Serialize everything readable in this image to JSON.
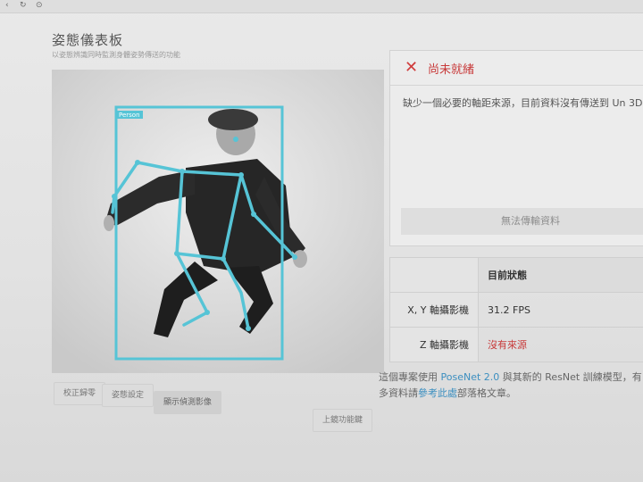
{
  "header": {
    "title": "姿態儀表板",
    "subtitle": "以姿態辨識同時監測身體姿勢傳送的功能"
  },
  "video": {
    "box_label": "Person"
  },
  "bottom_buttons": {
    "btn1": "校正歸零",
    "btn2": "姿態設定",
    "btn3": "顯示偵測影像",
    "btn4": "上鏡功能鍵"
  },
  "status": {
    "title": "尚未就緒",
    "message": "缺少一個必要的軸距來源，目前資料沒有傳送到 Un 3D。",
    "send_button": "無法傳輸資料"
  },
  "table": {
    "header": "目前狀態",
    "rows": [
      {
        "label": "X, Y 軸攝影機",
        "value": "31.2 FPS"
      },
      {
        "label": "Z 軸攝影機",
        "value": "沒有來源"
      }
    ]
  },
  "footer": {
    "part1": "這個專案使用 ",
    "link1": "PoseNet 2.0",
    "part2": " 與其新的 ResNet 訓練模型，有",
    "part3": "多資料請",
    "link2": "參考此處",
    "part4": "部落格文章。"
  },
  "colors": {
    "accent": "#3c8fc0",
    "error": "#c83a3a",
    "skeleton": "#56c4d6"
  }
}
